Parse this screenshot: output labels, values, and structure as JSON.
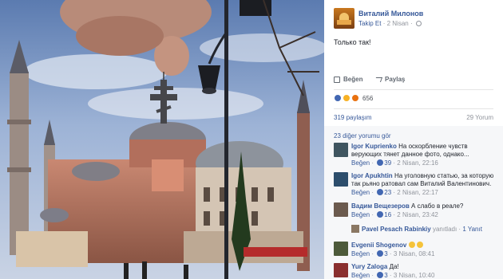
{
  "post": {
    "author": "Виталий Милонов",
    "follow_label": "Takip Et",
    "date": "2 Nisan",
    "text": "Только так!"
  },
  "actions": {
    "like_label": "Beğen",
    "share_label": "Paylaş"
  },
  "reactions": {
    "count": "656",
    "types": [
      "like",
      "wow",
      "angry"
    ]
  },
  "stats": {
    "shares": "319 paylaşım",
    "comments": "29 Yorum"
  },
  "comments": {
    "more_label": "23 diğer yorumu gör",
    "items": [
      {
        "name": "Igor Kuprienko",
        "text": "На оскорбление чувств верующих тянет данное фото, однако...",
        "like_label": "Beğen",
        "likes": "39",
        "date": "2 Nisan, 22:16"
      },
      {
        "name": "Igor Apukhtin",
        "text": "На уголовную статью, за которую так рьяно ратовал сам Виталий Валентинович.",
        "like_label": "Beğen",
        "likes": "23",
        "date": "2 Nisan, 22:17"
      },
      {
        "name": "Вадим Вещезеров",
        "text": "А слабо в реале?",
        "like_label": "Beğen",
        "likes": "16",
        "date": "2 Nisan, 23:42"
      },
      {
        "name": "Evgenii Shogenov",
        "text": "",
        "like_label": "Beğen",
        "likes": "3",
        "date": "3 Nisan, 08:41"
      },
      {
        "name": "Yury Zaloga",
        "text": "Да!",
        "like_label": "Beğen",
        "likes": "3",
        "date": "3 Nisan, 10:40"
      }
    ],
    "reply": {
      "name": "Pavel Pesach Rabinkiy",
      "action": "yanıtladı",
      "count": "1 Yanıt"
    }
  },
  "colors": {
    "link": "#365899",
    "meta": "#90949c",
    "like_blue": "#4267b2"
  }
}
